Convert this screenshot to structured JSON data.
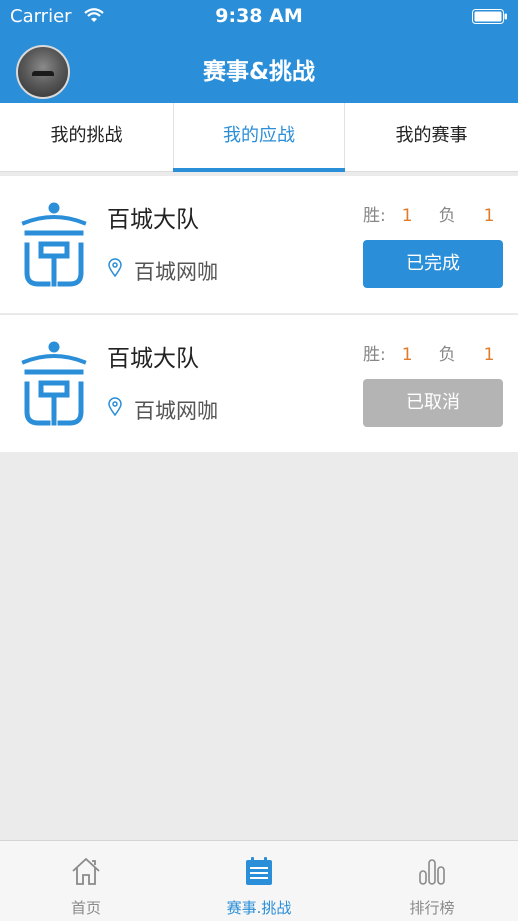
{
  "status_bar": {
    "carrier": "Carrier",
    "time": "9:38 AM"
  },
  "nav": {
    "title": "赛事&挑战"
  },
  "tabs": [
    {
      "label": "我的挑战",
      "active": false
    },
    {
      "label": "我的应战",
      "active": true
    },
    {
      "label": "我的赛事",
      "active": false
    }
  ],
  "challenges": [
    {
      "team": "百城大队",
      "location": "百城网咖",
      "win_label": "胜:",
      "wins": "1",
      "loss_label": "负",
      "losses": "1",
      "status": "已完成",
      "status_color": "#2b8ed8"
    },
    {
      "team": "百城大队",
      "location": "百城网咖",
      "win_label": "胜:",
      "wins": "1",
      "loss_label": "负",
      "losses": "1",
      "status": "已取消",
      "status_color": "#b4b4b4"
    }
  ],
  "tabbar": [
    {
      "label": "首页",
      "icon": "home-icon",
      "active": false
    },
    {
      "label": "赛事.挑战",
      "icon": "calendar-list-icon",
      "active": true
    },
    {
      "label": "排行榜",
      "icon": "bar-chart-icon",
      "active": false
    }
  ],
  "colors": {
    "primary": "#2b8ed8",
    "accent_number": "#e07b2a",
    "background": "#ebebeb"
  }
}
